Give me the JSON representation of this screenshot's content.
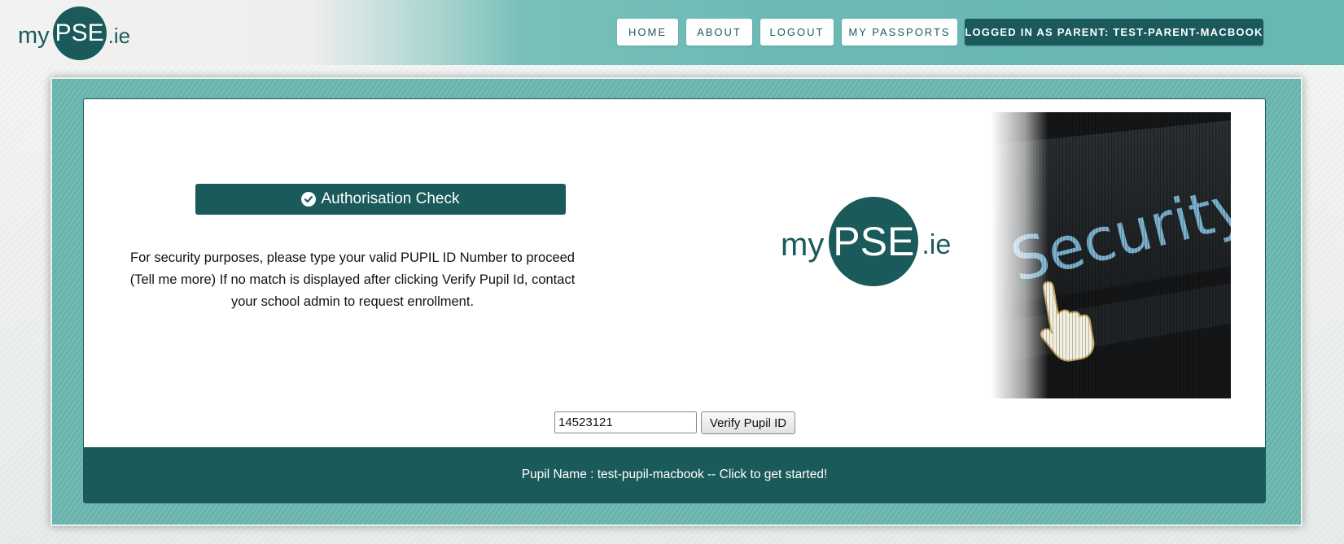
{
  "header": {
    "logo": {
      "prefix": "my",
      "mark": "PSE",
      "suffix": ".ie"
    },
    "nav": [
      {
        "label": "HOME"
      },
      {
        "label": "ABOUT"
      },
      {
        "label": "LOGOUT"
      },
      {
        "label": "MY PASSPORTS"
      }
    ],
    "user_status": "LOGGED IN AS PARENT: TEST-PARENT-MACBOOK"
  },
  "auth": {
    "icon": "check-circle-icon",
    "title": "Authorisation Check",
    "message": "For security purposes, please type your valid PUPIL ID Number to proceed (Tell me more) If no match is displayed after clicking Verify Pupil Id, contact your school admin to request enrollment."
  },
  "card_logo": {
    "prefix": "my",
    "mark": "PSE",
    "suffix": ".ie"
  },
  "security_image": {
    "text": "Security",
    "icon": "pointer-hand-icon"
  },
  "form": {
    "pupil_id_value": "14523121",
    "verify_label": "Verify Pupil ID"
  },
  "footer": {
    "pupil_line": "Pupil Name : test-pupil-macbook -- Click to get started!"
  },
  "colors": {
    "brand_dark": "#1b5a5a",
    "teal": "#6cb8b2",
    "white": "#ffffff"
  }
}
